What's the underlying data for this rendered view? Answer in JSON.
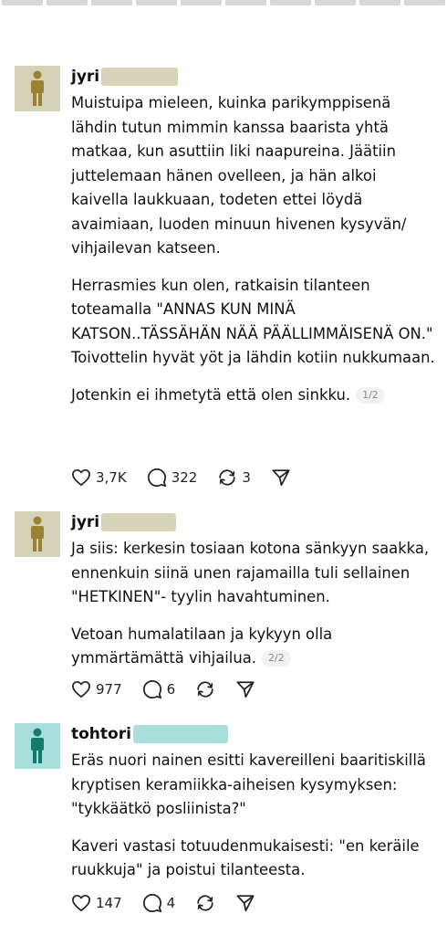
{
  "posts": [
    {
      "author": "jyri",
      "avatar_color": "#d6d2b8",
      "figure_color": "#9a8234",
      "redact_color": "#d6d2b8",
      "paragraphs": [
        "Muistuipa mieleen, kuinka parikymppisenä lähdin tutun mimmin kanssa baarista yhtä matkaa, kun asuttiin liki naapureina. Jäätiin juttelemaan hänen ovelleen, ja hän alkoi kaivella laukkuaan, todeten ettei löydä avaimiaan, luoden minuun hivenen kysyvän/ vihjailevan katseen.",
        "Herrasmies kun olen, ratkaisin tilanteen toteamalla \"ANNAS KUN MINÄ KATSON..TÄSSÄHÄN NÄÄ PÄÄLLIMMÄISENÄ ON.\"",
        "Toivottelin hyvät yöt ja lähdin kotiin nukkumaan.",
        "Jotenkin ei ihmetytä että olen sinkku."
      ],
      "pager": "1/2",
      "likes": "3,7K",
      "replies": "322",
      "reposts": "3"
    },
    {
      "author": "jyri",
      "avatar_color": "#d6d2b8",
      "figure_color": "#9a8234",
      "redact_color": "#d6d2b8",
      "paragraphs": [
        "Ja siis: kerkesin tosiaan kotona sänkyyn saakka, ennenkuin siinä unen rajamailla tuli sellainen \"HETKINEN\"- tyylin havahtuminen.",
        "Vetoan humalatilaan ja kykyyn olla ymmärtämättä vihjailua."
      ],
      "pager": "2/2",
      "likes": "977",
      "replies": "6"
    },
    {
      "author": "tohtori",
      "avatar_color": "#a8dedc",
      "figure_color": "#127a6f",
      "redact_color": "#a8dedc",
      "paragraphs": [
        "Eräs nuori nainen esitti kavereilleni baaritiskillä kryptisen keramiikka-aiheisen kysymyksen: \"tykkäätkö posliinista?\"",
        "Kaveri vastasi totuudenmukaisesti: \"en keräile ruukkuja\" ja poistui tilanteesta."
      ],
      "likes": "147",
      "replies": "4"
    }
  ],
  "icons": {
    "like": "heart-icon",
    "reply": "speech-bubble-icon",
    "repost": "repost-arrows-icon",
    "share": "paper-plane-icon"
  }
}
